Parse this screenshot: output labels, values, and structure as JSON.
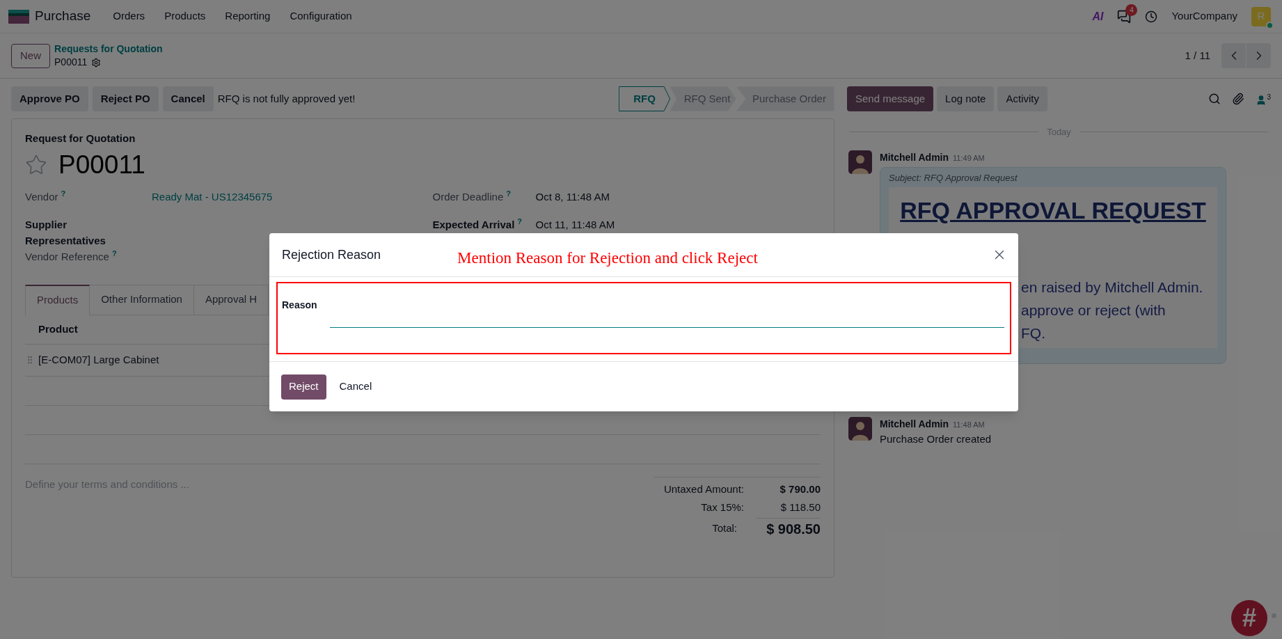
{
  "navbar": {
    "app": "Purchase",
    "menu": [
      "Orders",
      "Products",
      "Reporting",
      "Configuration"
    ],
    "ai_label": "AI",
    "notification_count": "4",
    "company": "YourCompany",
    "avatar_initial": "R"
  },
  "control_panel": {
    "new_button": "New",
    "breadcrumb": "Requests for Quotation",
    "record": "P00011",
    "pager": "1 / 11"
  },
  "actions": {
    "buttons": [
      "Approve PO",
      "Reject PO",
      "Cancel"
    ],
    "notice": "RFQ is not fully approved yet!"
  },
  "statusbar": [
    {
      "label": "RFQ",
      "selected": true
    },
    {
      "label": "RFQ Sent",
      "selected": false
    },
    {
      "label": "Purchase Order",
      "selected": false
    }
  ],
  "form": {
    "subtitle": "Request for Quotation",
    "title": "P00011",
    "starred": false,
    "fields_left": [
      {
        "label": "Vendor",
        "help": "?",
        "value": "Ready Mat - US12345675",
        "bold": false
      },
      {
        "label": "Supplier Representatives",
        "bold": true
      },
      {
        "label": "Vendor Reference",
        "help": "?",
        "bold": false
      }
    ],
    "fields_right": [
      {
        "label": "Order Deadline",
        "help": "?",
        "value": "Oct 8, 11:48 AM",
        "bold": false
      },
      {
        "label": "Expected Arrival",
        "help": "?",
        "value": "Oct 11, 11:48 AM",
        "bold": true
      }
    ],
    "tabs": [
      {
        "label": "Products",
        "selected": true
      },
      {
        "label": "Other Information",
        "selected": false
      },
      {
        "label": "Approval H",
        "selected": false
      }
    ],
    "table": {
      "columns": [
        "Product"
      ],
      "rows": [
        {
          "product": "[E-COM07] Large Cabinet"
        }
      ]
    },
    "terms_placeholder": "Define your terms and conditions ...",
    "totals": [
      {
        "label": "Untaxed Amount:",
        "value": "$ 790.00",
        "kind": "subtotal"
      },
      {
        "label": "Tax 15%:",
        "value": "$ 118.50",
        "kind": "tax"
      },
      {
        "label": "Total:",
        "value": "$ 908.50",
        "kind": "total"
      }
    ]
  },
  "chatter": {
    "buttons": [
      {
        "label": "Send message",
        "kind": "primary"
      },
      {
        "label": "Log note",
        "kind": "secondary"
      },
      {
        "label": "Activity",
        "kind": "secondary"
      }
    ],
    "follower_count": "3",
    "date_separator": "Today",
    "messages": [
      {
        "kind": "mail",
        "author": "Mitchell Admin",
        "time": "11:49 AM",
        "subject": "Subject: RFQ Approval Request",
        "heading": "RFQ APPROVAL REQUEST",
        "body_lines": [
          "en raised by Mitchell Admin.",
          "approve or reject (with",
          "FQ."
        ]
      },
      {
        "kind": "note",
        "author": "Mitchell Admin",
        "time": "11:48 AM",
        "text": "Purchase Order created"
      }
    ]
  },
  "support_glyph": "#",
  "dialog": {
    "title": "Rejection Reason",
    "annotation": "Mention Reason for Rejection and click Reject",
    "field_label": "Reason",
    "buttons": [
      {
        "label": "Reject",
        "kind": "primary"
      },
      {
        "label": "Cancel",
        "kind": "secondary"
      }
    ]
  }
}
